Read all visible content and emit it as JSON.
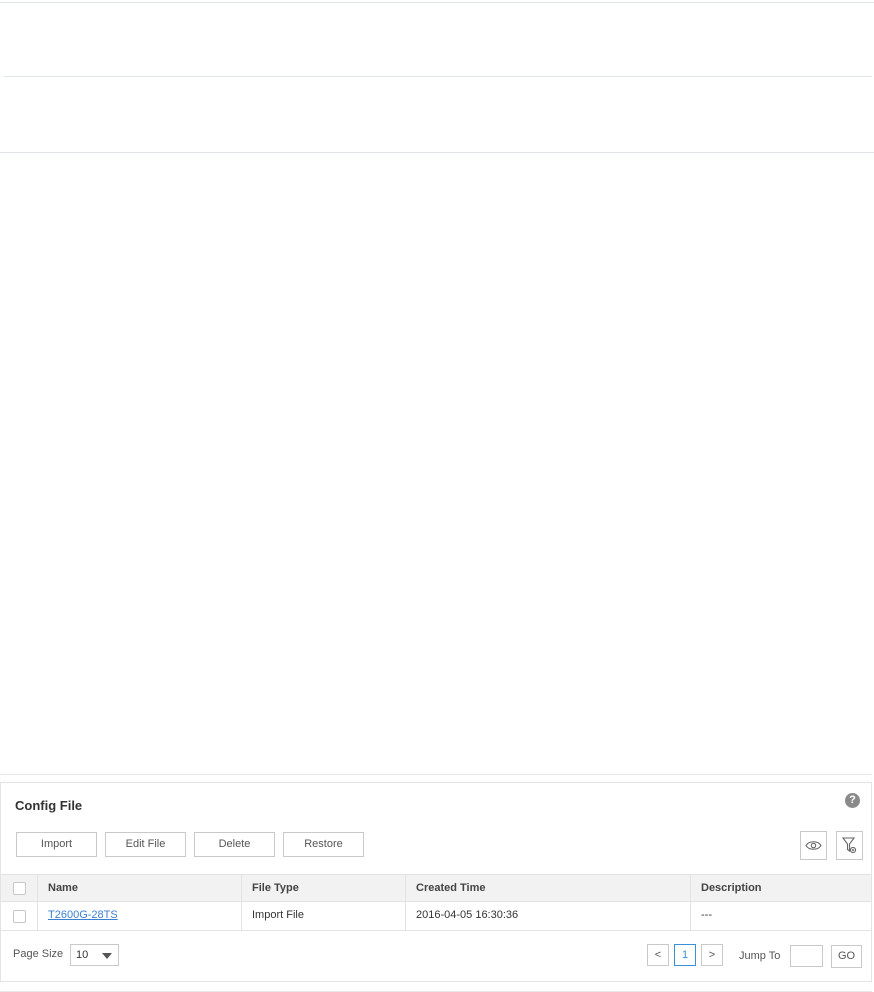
{
  "panel": {
    "title": "Config File",
    "help_symbol": "?"
  },
  "toolbar": {
    "import_label": "Import",
    "edit_label": "Edit File",
    "delete_label": "Delete",
    "restore_label": "Restore",
    "view_icon": "eye-icon",
    "filter_icon": "filter-icon"
  },
  "table": {
    "columns": [
      "Name",
      "File Type",
      "Created Time",
      "Description"
    ],
    "rows": [
      {
        "name": "T2600G-28TS",
        "file_type": "Import File",
        "created_time": "2016-04-05 16:30:36",
        "description": "---"
      }
    ]
  },
  "pagination": {
    "page_size_label": "Page Size",
    "page_size_value": "10",
    "prev_label": "<",
    "current_page": "1",
    "next_label": ">",
    "jump_label": "Jump To",
    "go_label": "GO"
  },
  "colors": {
    "link": "#3a7fd0",
    "accent": "#3a8fd8",
    "border": "#c9c9c9"
  }
}
